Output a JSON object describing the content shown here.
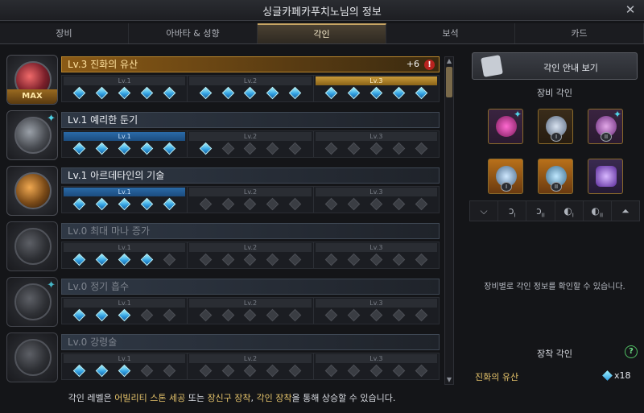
{
  "window": {
    "title": "싱글카페카푸치노님의 정보"
  },
  "tabs": [
    {
      "label": "장비"
    },
    {
      "label": "아바타 & 성향"
    },
    {
      "label": "각인"
    },
    {
      "label": "보석"
    },
    {
      "label": "카드"
    }
  ],
  "engravings": [
    {
      "name": "Lv.3 진화의 유산",
      "extra": "+6",
      "max_label": "MAX",
      "segments": [
        "Lv.1",
        "Lv.2",
        "Lv.3"
      ]
    },
    {
      "name": "Lv.1 예리한 둔기",
      "segments": [
        "Lv.1",
        "Lv.2",
        "Lv.3"
      ]
    },
    {
      "name": "Lv.1 아르데타인의 기술",
      "segments": [
        "Lv.1",
        "Lv.2",
        "Lv.3"
      ]
    },
    {
      "name": "Lv.0 최대 마나 증가",
      "segments": [
        "Lv.1",
        "Lv.2",
        "Lv.3"
      ]
    },
    {
      "name": "Lv.0 정기 흡수",
      "segments": [
        "Lv.1",
        "Lv.2",
        "Lv.3"
      ]
    },
    {
      "name": "Lv.0 강령술",
      "segments": [
        "Lv.1",
        "Lv.2",
        "Lv.3"
      ]
    }
  ],
  "footer": {
    "part1": "각인 레벨은 ",
    "hl1": "어빌리티 스톤 세공",
    "part2": " 또는 ",
    "hl2": "장신구 장착",
    "part3": ", ",
    "hl3": "각인 장착",
    "part4": "을 통해 상승할 수 있습니다."
  },
  "panel": {
    "guide_label": "각인 안내 보기",
    "equip_title": "장비 각인",
    "hint": "장비별로 각인 정보를 확인할 수 있습니다.",
    "mount_title": "장착 각인",
    "mounted": {
      "name": "진화의 유산",
      "count": "x18"
    }
  }
}
